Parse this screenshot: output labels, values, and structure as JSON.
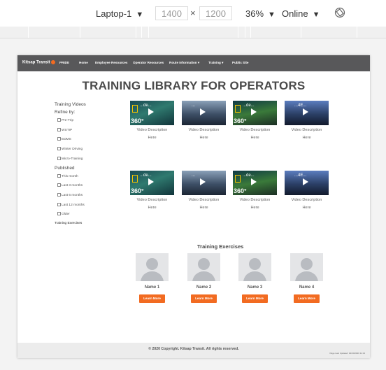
{
  "devtools": {
    "device": "Laptop-1",
    "width_value": "1400",
    "height_value": "1200",
    "times": "×",
    "zoom": "36%",
    "network": "Online",
    "arrow": "▼"
  },
  "nav": {
    "logo": "Kitsap Transit",
    "items": [
      "PRIDE",
      "Home",
      "Employee Resources",
      "Operator Resources",
      "Route Information ▾",
      "Training ▾",
      "Public Site"
    ]
  },
  "page_title": "TRAINING LIBRARY FOR OPERATORS",
  "sidebar": {
    "heading": "Training Videos",
    "refine": "Refine by:",
    "filters": [
      "Pre-Trip",
      "WSTIP",
      "EDMS",
      "Winter Driving",
      "Micro-Training"
    ],
    "published_heading": "Published",
    "published": [
      "This month",
      "Last 3 months",
      "Last 6 months",
      "Last 12 months",
      "Older"
    ],
    "exercises_link": "Training Exercises"
  },
  "videos": {
    "caption_line1": "Video Description",
    "caption_line2": "Here",
    "badge": "360°",
    "thumb_titles": [
      "...de...",
      "...",
      "...de...",
      "...4E..."
    ]
  },
  "exercises": {
    "title": "Training Exercises",
    "people": [
      "Name 1",
      "Name 2",
      "Name 3",
      "Name 4"
    ],
    "button_label": "Learn More"
  },
  "footer": {
    "copyright": "© 2020 Copyright. Kitsap Transit. All rights reserved.",
    "updated": "Page Last Updated: 02/20/2020 11:13"
  },
  "colors": {
    "nav_bg": "#58585a",
    "accent": "#f26b21",
    "footer_bg": "#ececec"
  }
}
